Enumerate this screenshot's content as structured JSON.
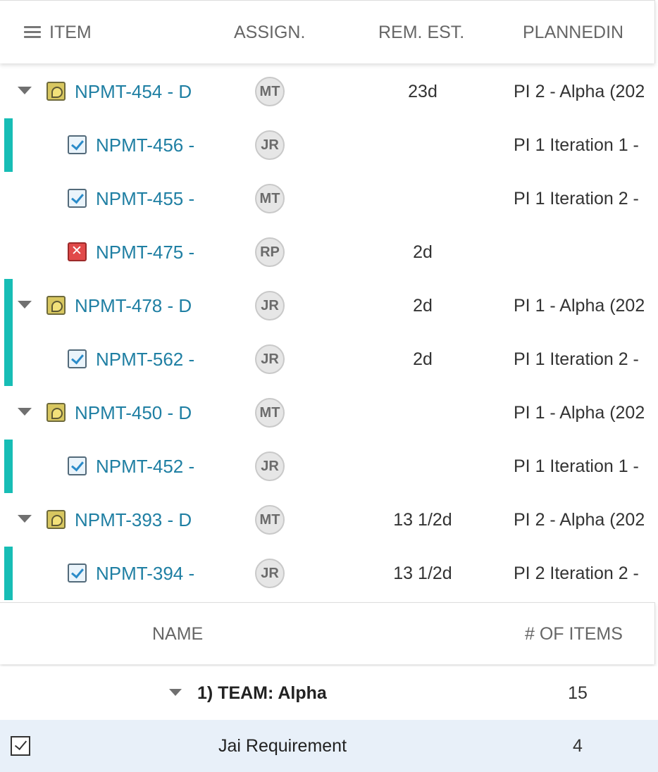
{
  "columns": {
    "item": "ITEM",
    "assignee": "ASSIGN.",
    "remaining_estimate": "REM. EST.",
    "planned_in": "PLANNEDIN"
  },
  "colors": {
    "link": "#1f7fa3",
    "band": "#17bdb5",
    "selected_row_bg": "#e8f0f9"
  },
  "rows": [
    {
      "id": "NPMT-454 - D",
      "type": "epic-icon",
      "level": 0,
      "expanded": true,
      "band": false,
      "assignee": "MT",
      "rem_est": "23d",
      "planned_in": "PI 2 - Alpha (202"
    },
    {
      "id": "NPMT-456 -",
      "type": "story-icon",
      "level": 1,
      "band": true,
      "assignee": "JR",
      "rem_est": "",
      "planned_in": "PI 1 Iteration 1 -"
    },
    {
      "id": "NPMT-455 -",
      "type": "story-icon",
      "level": 1,
      "band": false,
      "assignee": "MT",
      "rem_est": "",
      "planned_in": "PI 1 Iteration 2 -"
    },
    {
      "id": "NPMT-475 -",
      "type": "defect-icon",
      "level": 1,
      "band": false,
      "assignee": "RP",
      "rem_est": "2d",
      "planned_in": ""
    },
    {
      "id": "NPMT-478 - D",
      "type": "epic-icon",
      "level": 0,
      "expanded": true,
      "band": true,
      "assignee": "JR",
      "rem_est": "2d",
      "planned_in": "PI 1 - Alpha (202"
    },
    {
      "id": "NPMT-562 -",
      "type": "story-icon",
      "level": 1,
      "band": true,
      "assignee": "JR",
      "rem_est": "2d",
      "planned_in": "PI 1 Iteration 2 -"
    },
    {
      "id": "NPMT-450 - D",
      "type": "epic-icon",
      "level": 0,
      "expanded": true,
      "band": false,
      "assignee": "MT",
      "rem_est": "",
      "planned_in": "PI 1 - Alpha (202"
    },
    {
      "id": "NPMT-452 -",
      "type": "story-icon",
      "level": 1,
      "band": true,
      "assignee": "JR",
      "rem_est": "",
      "planned_in": "PI 1 Iteration 1 -"
    },
    {
      "id": "NPMT-393 - D",
      "type": "epic-icon",
      "level": 0,
      "expanded": true,
      "band": false,
      "assignee": "MT",
      "rem_est": "13 1/2d",
      "planned_in": "PI 2 - Alpha (202"
    },
    {
      "id": "NPMT-394 -",
      "type": "story-icon",
      "level": 1,
      "band": true,
      "assignee": "JR",
      "rem_est": "13 1/2d",
      "planned_in": "PI 2 Iteration 2 -"
    }
  ],
  "summary": {
    "columns": {
      "name": "NAME",
      "count": "# OF ITEMS"
    },
    "group": {
      "label": "1) TEAM: Alpha",
      "count": "15",
      "expanded": true
    },
    "selected_row": {
      "label": "Jai Requirement",
      "count": "4",
      "checked": true
    }
  }
}
